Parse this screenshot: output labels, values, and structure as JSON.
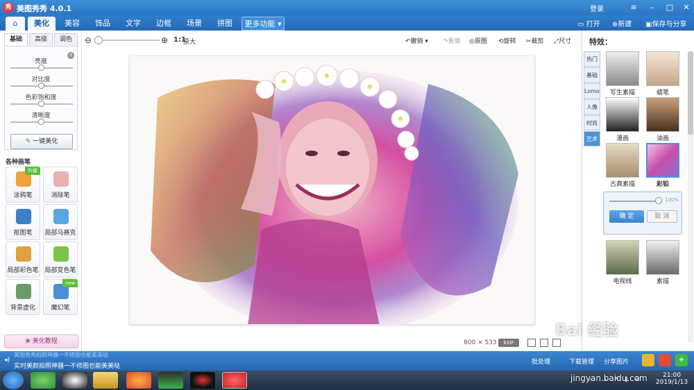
{
  "app": {
    "title": "美图秀秀 4.0.1",
    "logo_text": "秀",
    "login": "登录"
  },
  "window_controls": {
    "menu": "≡",
    "minimize": "–",
    "maximize": "□",
    "close": "✕"
  },
  "menu": {
    "home": "⌂",
    "tabs": [
      "美化",
      "美容",
      "饰品",
      "文字",
      "边框",
      "场景",
      "拼图",
      "更多功能"
    ],
    "active": "美化",
    "open": "打开",
    "new": "新建",
    "save": "保存与分享"
  },
  "toolbar": {
    "zoom_out": "⊖",
    "zoom_in": "⊕",
    "ratio": "1:1",
    "original_size": "原大",
    "undo": "撤销",
    "redo": "重做",
    "original": "原图",
    "rotate": "旋转",
    "crop": "裁剪",
    "resize": "尺寸"
  },
  "left": {
    "subtabs": [
      "基础",
      "高级",
      "调色"
    ],
    "active_subtab": "基础",
    "adjust": {
      "help": "?",
      "brightness": "亮度",
      "contrast": "对比度",
      "saturation": "色彩饱和度",
      "sharpness": "清晰度"
    },
    "onekey": "一键美化",
    "brush_title": "各种画笔",
    "brushes": [
      {
        "label": "涂鸦笔",
        "badge": "升级",
        "color": "#f0a23a"
      },
      {
        "label": "消除笔",
        "badge": "",
        "color": "#e8b0b0"
      },
      {
        "label": "抠图笔",
        "badge": "",
        "color": "#3d7fc9"
      },
      {
        "label": "局部马赛克",
        "badge": "",
        "color": "#58a8e0"
      },
      {
        "label": "局部彩色笔",
        "badge": "",
        "color": "#e0a040"
      },
      {
        "label": "局部变色笔",
        "badge": "",
        "color": "#7cc24a"
      },
      {
        "label": "背景虚化",
        "badge": "",
        "color": "#6a9c6a"
      },
      {
        "label": "魔幻笔",
        "badge": "new",
        "color": "#4a8fd8"
      }
    ],
    "tutorial": "美化教程"
  },
  "status": {
    "width": "800",
    "x": "×",
    "height": "533",
    "exif": "EXIF"
  },
  "right": {
    "title": "特效：",
    "vtabs": [
      "热门",
      "基础",
      "Lomo",
      "人像",
      "时尚",
      "艺术"
    ],
    "active_vtab": "艺术",
    "effects": [
      {
        "label": "写生素描",
        "tone": "#9a9a9a"
      },
      {
        "label": "蜡笔",
        "tone": "#c6a58a"
      },
      {
        "label": "漫画",
        "tone": "#222"
      },
      {
        "label": "油画",
        "tone": "#6a4a30"
      },
      {
        "label": "古典素描",
        "tone": "#b39c7a"
      },
      {
        "label": "彩铅",
        "tone": "#d976b8"
      },
      {
        "label": "电视线",
        "tone": "#6b7a55"
      },
      {
        "label": "素描",
        "tone": "#777"
      }
    ],
    "selected_effect": "彩铅",
    "popup": {
      "opacity": "100%",
      "confirm": "确 定",
      "cancel": "取 消"
    }
  },
  "appstrip": {
    "marquee_prev": "美图秀秀拍照神器一不修图也能美美哒",
    "marquee": "实时美颜拍照神器一不修图也能美美哒",
    "batch": "批处理",
    "download": "下载管理",
    "share": "分享图片"
  },
  "taskbar": {
    "time": "21:00",
    "date": "2019/1/13"
  },
  "watermark": {
    "main": "Bai 经验",
    "url": "jingyan.baidu.com"
  }
}
